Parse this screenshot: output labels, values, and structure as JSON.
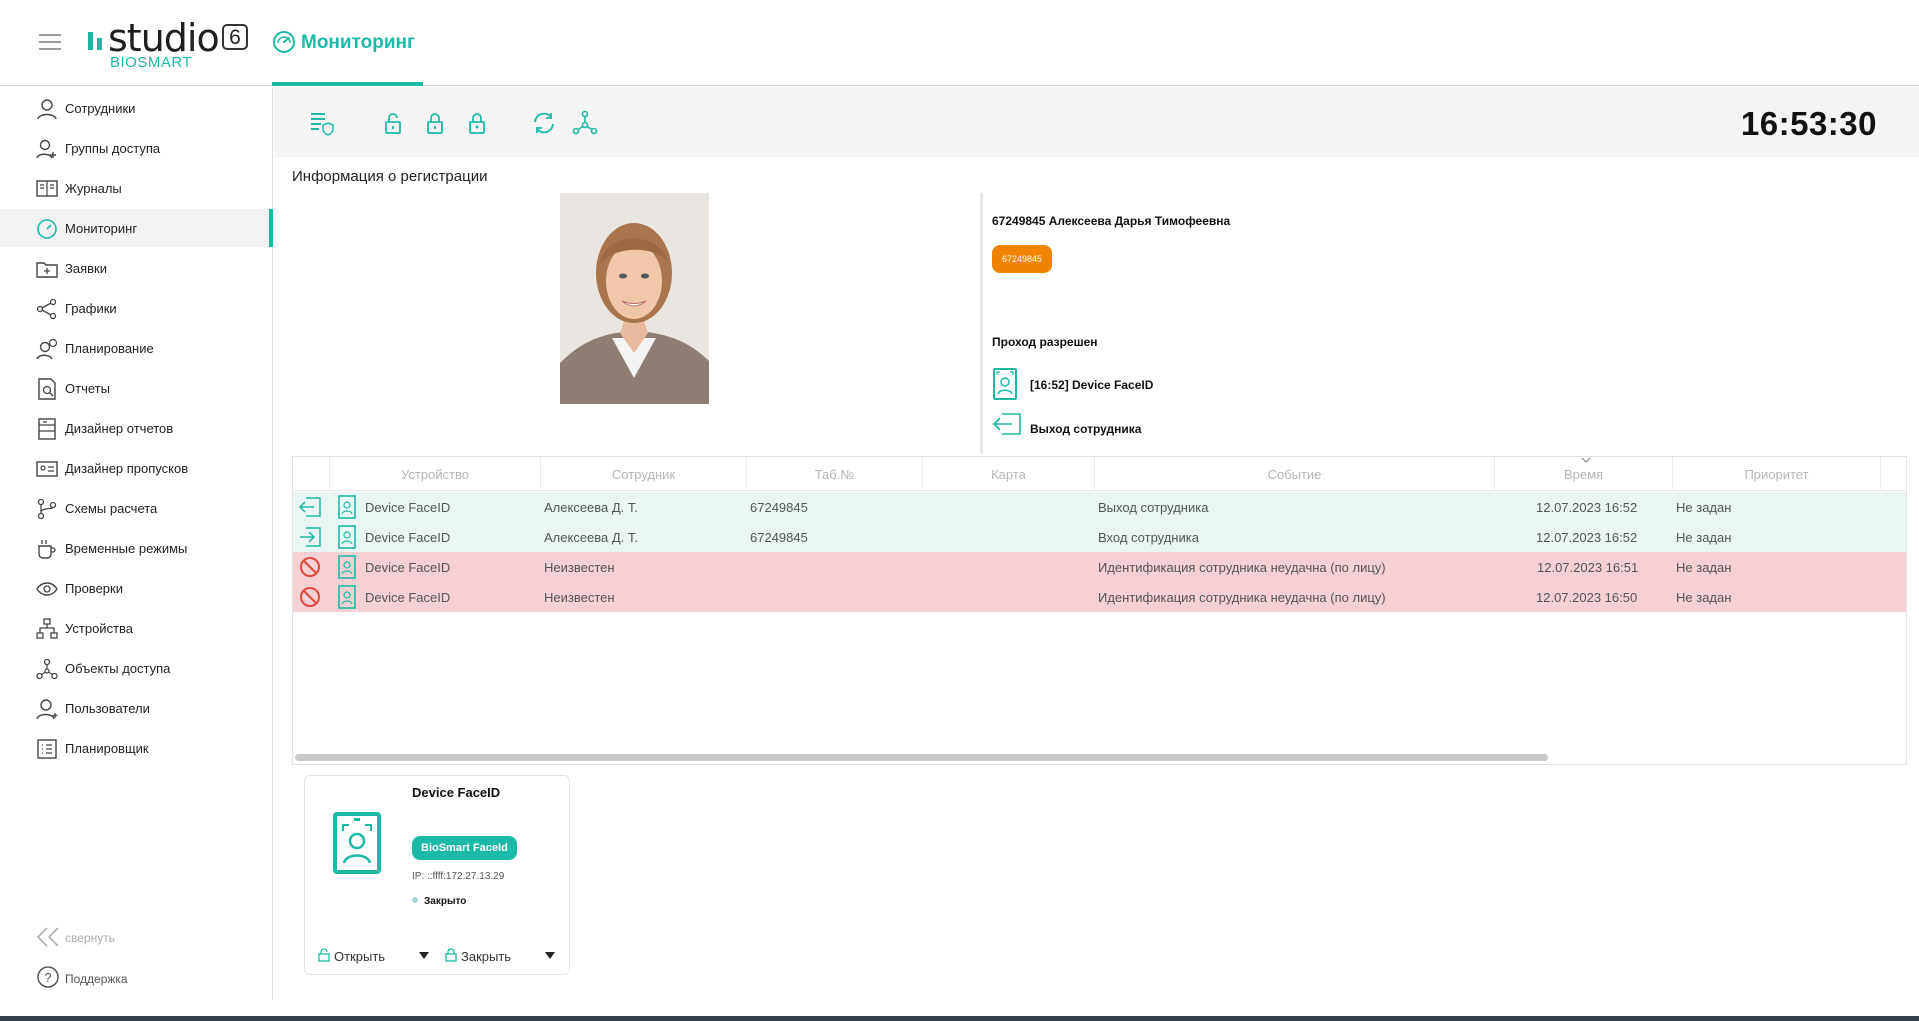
{
  "header": {
    "logo_text": "studio",
    "logo_version": "6",
    "logo_sub": "BIOSMART",
    "page_title": "Мониторинг"
  },
  "sidebar": {
    "items": [
      {
        "label": "Сотрудники",
        "icon": "user-icon"
      },
      {
        "label": "Группы доступа",
        "icon": "users-group-icon"
      },
      {
        "label": "Журналы",
        "icon": "book-icon"
      },
      {
        "label": "Мониторинг",
        "icon": "gauge-icon",
        "active": true
      },
      {
        "label": "Заявки",
        "icon": "folder-add-icon"
      },
      {
        "label": "Графики",
        "icon": "share-icon"
      },
      {
        "label": "Планирование",
        "icon": "user-clock-icon"
      },
      {
        "label": "Отчеты",
        "icon": "report-search-icon"
      },
      {
        "label": "Дизайнер отчетов",
        "icon": "report-designer-icon"
      },
      {
        "label": "Дизайнер пропусков",
        "icon": "id-card-icon"
      },
      {
        "label": "Схемы расчета",
        "icon": "branch-icon"
      },
      {
        "label": "Временные режимы",
        "icon": "cup-icon"
      },
      {
        "label": "Проверки",
        "icon": "eye-icon"
      },
      {
        "label": "Устройства",
        "icon": "hierarchy-icon"
      },
      {
        "label": "Объекты доступа",
        "icon": "nodes-icon"
      },
      {
        "label": "Пользователи",
        "icon": "user-add-icon"
      },
      {
        "label": "Планировщик",
        "icon": "list-icon"
      }
    ],
    "collapse_label": "свернуть",
    "support_label": "Поддержка"
  },
  "toolbar": {
    "clock": "16:53:30",
    "buttons": [
      "settings-shield-icon",
      "unlock-icon",
      "lock-icon",
      "lock-alt-icon",
      "refresh-icon",
      "network-icon"
    ]
  },
  "registration": {
    "title": "Информация о регистрации",
    "person_name": "67249845 Алексеева Дарья Тимофеевна",
    "card_number": "67249845",
    "pass_status": "Проход разрешен",
    "device_line": "[16:52] Device FaceID",
    "event_line": "Выход сотрудника"
  },
  "table": {
    "columns": [
      "Устройство",
      "Сотрудник",
      "Таб.№",
      "Карта",
      "Событие",
      "Время",
      "Приоритет"
    ],
    "rows": [
      {
        "status": "ok",
        "direction": "exit",
        "device": "Device FaceID",
        "employee": "Алексеева Д. Т.",
        "tab_no": "67249845",
        "card": "",
        "event": "Выход сотрудника",
        "time": "12.07.2023 16:52",
        "priority": "Не задан"
      },
      {
        "status": "ok",
        "direction": "enter",
        "device": "Device FaceID",
        "employee": "Алексеева Д. Т.",
        "tab_no": "67249845",
        "card": "",
        "event": "Вход сотрудника",
        "time": "12.07.2023 16:52",
        "priority": "Не задан"
      },
      {
        "status": "fail",
        "direction": "denied",
        "device": "Device FaceID",
        "employee": "Неизвестен",
        "tab_no": "",
        "card": "",
        "event": "Идентификация сотрудника неудачна (по лицу)",
        "time": "12.07.2023 16:51",
        "priority": "Не задан"
      },
      {
        "status": "fail",
        "direction": "denied",
        "device": "Device FaceID",
        "employee": "Неизвестен",
        "tab_no": "",
        "card": "",
        "event": "Идентификация сотрудника неудачна (по лицу)",
        "time": "12.07.2023 16:50",
        "priority": "Не задан"
      }
    ]
  },
  "device_card": {
    "title": "Device FaceID",
    "type_badge": "BioSmart FaceId",
    "ip": "IP:  ::ffff:172.27.13.29",
    "state": "Закрыто",
    "open_label": "Открыть",
    "close_label": "Закрыть"
  },
  "colors": {
    "accent": "#1db9a7",
    "badge_orange": "#f08400",
    "row_ok": "#e9f6f4",
    "row_fail": "#f5d0d5",
    "denied": "#e24b3b"
  }
}
